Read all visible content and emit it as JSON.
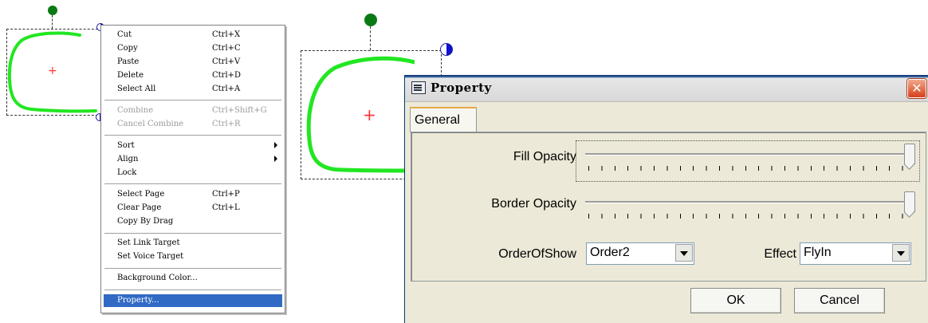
{
  "context_menu": {
    "items": [
      {
        "label": "Cut",
        "shortcut": "Ctrl+X"
      },
      {
        "label": "Copy",
        "shortcut": "Ctrl+C"
      },
      {
        "label": "Paste",
        "shortcut": "Ctrl+V"
      },
      {
        "label": "Delete",
        "shortcut": "Ctrl+D"
      },
      {
        "label": "Select All",
        "shortcut": "Ctrl+A"
      },
      {
        "label": "Combine",
        "shortcut": "Ctrl+Shift+G"
      },
      {
        "label": "Cancel Combine",
        "shortcut": "Ctrl+R"
      },
      {
        "label": "Sort"
      },
      {
        "label": "Align"
      },
      {
        "label": "Lock"
      },
      {
        "label": "Select Page",
        "shortcut": "Ctrl+P"
      },
      {
        "label": "Clear Page",
        "shortcut": "Ctrl+L"
      },
      {
        "label": "Copy By Drag"
      },
      {
        "label": "Set Link Target"
      },
      {
        "label": "Set Voice Target"
      },
      {
        "label": "Background Color..."
      },
      {
        "label": "Property..."
      }
    ],
    "highlighted": "Property..."
  },
  "dialog": {
    "title": "Property",
    "close_glyph": "✕",
    "tab_label": "General",
    "fill_opacity_label": "Fill Opacity",
    "fill_opacity_value": 1.0,
    "border_opacity_label": "Border Opacity",
    "border_opacity_value": 1.0,
    "order_label": "OrderOfShow",
    "order_value": "Order2",
    "effect_label": "Effect",
    "effect_value": "FlyIn",
    "ok_label": "OK",
    "cancel_label": "Cancel"
  },
  "colors": {
    "stroke": "#22e622",
    "rotate_handle": "#0a7a14",
    "center_mark": "#ff3333",
    "menu_highlight": "#316ac5",
    "close_button": "#d6401c"
  },
  "icons": {
    "center_mark": "+"
  }
}
